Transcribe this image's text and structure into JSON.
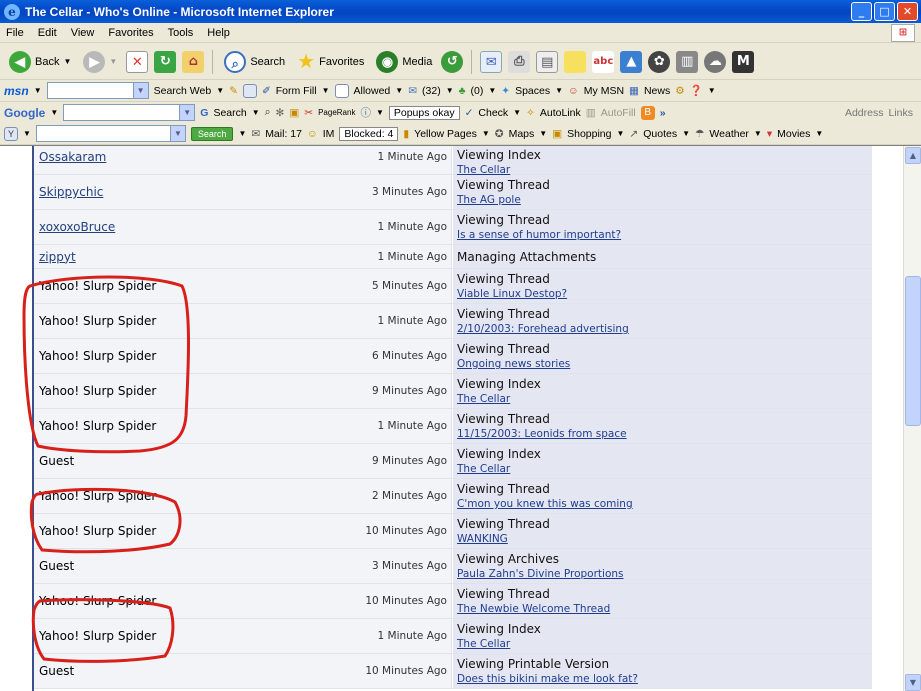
{
  "window": {
    "title": "The Cellar - Who's Online - Microsoft Internet Explorer",
    "buttons": [
      "_",
      "□",
      "✕"
    ]
  },
  "menu": [
    "File",
    "Edit",
    "View",
    "Favorites",
    "Tools",
    "Help"
  ],
  "std_toolbar": {
    "back": "Back",
    "search": "Search",
    "favorites": "Favorites",
    "media": "Media"
  },
  "msn_toolbar": {
    "logo": "msn",
    "search_web": "Search Web",
    "form_fill": "Form Fill",
    "allowed": "Allowed",
    "mail_count": "(32)",
    "im_count": "(0)",
    "spaces": "Spaces",
    "my_msn": "My MSN",
    "news": "News"
  },
  "google_toolbar": {
    "logo": "Google",
    "search": "Search",
    "pagerank": "PageRank",
    "popups": "Popups okay",
    "check": "Check",
    "autolink": "AutoLink",
    "autofill": "AutoFill",
    "address": "Address",
    "links": "Links"
  },
  "yahoo_toolbar": {
    "search_btn": "Search",
    "mail": "Mail: 17",
    "im": "IM",
    "blocked": "Blocked: 4",
    "yellow_pages": "Yellow Pages",
    "maps": "Maps",
    "shopping": "Shopping",
    "quotes": "Quotes",
    "weather": "Weather",
    "movies": "Movies"
  },
  "rows": [
    {
      "user": "Ossakaram",
      "link": true,
      "time": "1 Minute Ago",
      "action": "Viewing Index",
      "target": "The Cellar"
    },
    {
      "user": "Skippychic",
      "link": true,
      "time": "3 Minutes Ago",
      "action": "Viewing Thread",
      "target": "The AG pole"
    },
    {
      "user": "xoxoxoBruce",
      "link": true,
      "time": "1 Minute Ago",
      "action": "Viewing Thread",
      "target": "Is a sense of humor important?"
    },
    {
      "user": "zippyt",
      "link": true,
      "time": "1 Minute Ago",
      "action": "Managing Attachments",
      "target": ""
    },
    {
      "user": "Yahoo! Slurp Spider",
      "link": false,
      "time": "5 Minutes Ago",
      "action": "Viewing Thread",
      "target": "Viable Linux Destop?"
    },
    {
      "user": "Yahoo! Slurp Spider",
      "link": false,
      "time": "1 Minute Ago",
      "action": "Viewing Thread",
      "target": "2/10/2003: Forehead advertising"
    },
    {
      "user": "Yahoo! Slurp Spider",
      "link": false,
      "time": "6 Minutes Ago",
      "action": "Viewing Thread",
      "target": "Ongoing news stories"
    },
    {
      "user": "Yahoo! Slurp Spider",
      "link": false,
      "time": "9 Minutes Ago",
      "action": "Viewing Index",
      "target": "The Cellar"
    },
    {
      "user": "Yahoo! Slurp Spider",
      "link": false,
      "time": "1 Minute Ago",
      "action": "Viewing Thread",
      "target": "11/15/2003: Leonids from space"
    },
    {
      "user": "Guest",
      "link": false,
      "time": "9 Minutes Ago",
      "action": "Viewing Index",
      "target": "The Cellar"
    },
    {
      "user": "Yahoo! Slurp Spider",
      "link": false,
      "time": "2 Minutes Ago",
      "action": "Viewing Thread",
      "target": "C'mon you knew this was coming"
    },
    {
      "user": "Yahoo! Slurp Spider",
      "link": false,
      "time": "10 Minutes Ago",
      "action": "Viewing Thread",
      "target": "WANKING"
    },
    {
      "user": "Guest",
      "link": false,
      "time": "3 Minutes Ago",
      "action": "Viewing Archives",
      "target": "Paula Zahn's Divine Proportions"
    },
    {
      "user": "Yahoo! Slurp Spider",
      "link": false,
      "time": "10 Minutes Ago",
      "action": "Viewing Thread",
      "target": "The Newbie Welcome Thread"
    },
    {
      "user": "Yahoo! Slurp Spider",
      "link": false,
      "time": "1 Minute Ago",
      "action": "Viewing Index",
      "target": "The Cellar"
    },
    {
      "user": "Guest",
      "link": false,
      "time": "10 Minutes Ago",
      "action": "Viewing Printable Version",
      "target": "Does this bikini make me look fat?"
    }
  ],
  "colors": {
    "annotation": "#d8201a",
    "link": "#23417d"
  }
}
